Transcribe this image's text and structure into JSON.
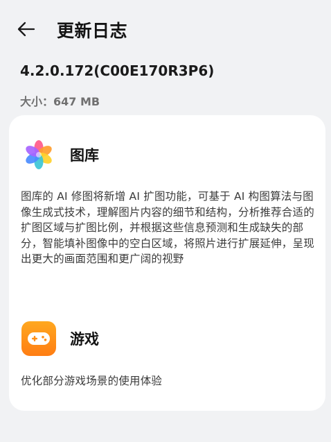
{
  "header": {
    "title": "更新日志",
    "back_icon": "back-arrow-icon"
  },
  "release": {
    "version": "4.2.0.172(C00E170R3P6)",
    "size_label": "大小：",
    "size_value": "647 MB"
  },
  "sections": [
    {
      "app_name": "图库",
      "icon": "gallery-flower-icon",
      "description": "图库的 AI 修图将新增 AI 扩图功能，可基于 AI 构图算法与图像生成式技术，理解图片内容的细节和结构，分析推荐合适的扩图区域与扩图比例，并根据这些信息预测和生成缺失的部分，智能填补图像中的空白区域，将照片进行扩展延伸，呈现出更大的画面范围和更广阔的视野"
    },
    {
      "app_name": "游戏",
      "icon": "gamepad-icon",
      "description": "优化部分游戏场景的使用体验"
    }
  ],
  "colors": {
    "background": "#f1f2f4",
    "card": "#ffffff",
    "game_icon_orange": "#ff8f16"
  }
}
